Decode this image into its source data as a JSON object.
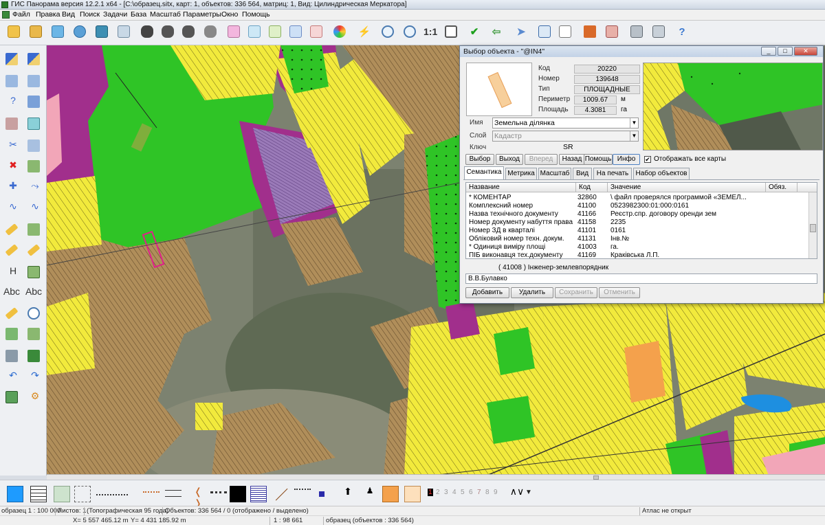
{
  "window": {
    "title": "ГИС Панорама версия 12.2.1 x64 - [C:\\образец.sitx, карт: 1, объектов: 336 564, матриц: 1, Вид: Цилиндрическая Меркатора]"
  },
  "menu": [
    "Файл",
    "Правка",
    "Вид",
    "Поиск",
    "Задачи",
    "База",
    "Масштаб",
    "Параметры",
    "Окно",
    "Помощь"
  ],
  "toolbar": {
    "scale_one_to_one": "1:1",
    "icons": [
      "open-folder-icon",
      "open-map-icon",
      "add-map-icon",
      "globe-info-icon",
      "layers-icon",
      "map-edit-icon",
      "binoculars-icon",
      "binoculars-search-icon",
      "binoculars-list-icon",
      "binoculars-area-icon",
      "select-object-icon",
      "select-add-icon",
      "select-plus-icon",
      "select-tag-icon",
      "select-clear-icon",
      "color-palette-icon",
      "lightning-icon",
      "zoom-out-icon",
      "zoom-in-icon",
      "zoom-fit-icon",
      "check-icon",
      "undo-icon",
      "pointer-icon",
      "monitor-icon",
      "text-document-icon",
      "tools-icon",
      "route-icon",
      "printer-icon",
      "print-preview-icon",
      "help-cursor-icon"
    ]
  },
  "left_toolbar": {
    "labels": [
      "H",
      "Abc",
      "Abc"
    ]
  },
  "dialog": {
    "title": "Выбор объекта - \"@IN4\"",
    "window_controls": [
      "_",
      "□",
      "✕"
    ],
    "attributes": [
      {
        "label": "Код",
        "value": "20220",
        "unit": ""
      },
      {
        "label": "Номер",
        "value": "139648",
        "unit": ""
      },
      {
        "label": "Тип",
        "value": "ПЛОЩАДНЫЕ",
        "unit": ""
      },
      {
        "label": "Периметр",
        "value": "1009.67",
        "unit": "м"
      },
      {
        "label": "Площадь",
        "value": "4.3081",
        "unit": "га"
      }
    ],
    "name_label": "Имя",
    "name_value": "Земельна ділянка",
    "layer_label": "Слой",
    "layer_value": "Кадастр",
    "key_label": "Ключ",
    "key_value": "SR",
    "buttons": [
      "Выбор",
      "Выход",
      "Вперед",
      "Назад",
      "Помощь",
      "Инфо"
    ],
    "show_all_maps": "Отображать все карты",
    "show_all_maps_checked": true,
    "tabs": [
      "Семантика",
      "Метрика",
      "Масштаб",
      "Вид",
      "На печать",
      "Набор объектов"
    ],
    "table_headers": [
      "Название",
      "Код",
      "Значение",
      "Обяз."
    ],
    "table_rows": [
      {
        "name": "* КОМЕНТАР",
        "code": "32860",
        "value": "\\ файл проверялся программой «ЗЕМЕЛ..."
      },
      {
        "name": "Комплексний номер",
        "code": "41100",
        "value": "0523982300:01:000:0161"
      },
      {
        "name": "Назва технічного документу",
        "code": "41166",
        "value": "Реєстр.спр. договору оренди зем"
      },
      {
        "name": "Номер документу набуття права",
        "code": "41158",
        "value": "2235"
      },
      {
        "name": "Номер ЗД в кварталі",
        "code": "41101",
        "value": "0161"
      },
      {
        "name": "Обліковий номер техн. докум.",
        "code": "41131",
        "value": "Інв.№"
      },
      {
        "name": "* Одиниця виміру площі",
        "code": "41003",
        "value": "га."
      },
      {
        "name": "ПІБ виконавця тех.документу",
        "code": "41169",
        "value": "Кракiвська Л.П."
      }
    ],
    "hint": "( 41008 ) Інженер-землевпорядник",
    "value_input": "В.В.Булавко",
    "bottom_buttons": [
      "Добавить",
      "Удалить",
      "Сохранить",
      "Отменить"
    ]
  },
  "bottom_toolbar": {
    "digits": [
      "1",
      "2",
      "3",
      "4",
      "5",
      "6",
      "7",
      "8",
      "9"
    ],
    "arrow_label": "▼"
  },
  "status": {
    "map_scale": "образец  1 : 100 000",
    "sheets": "Листов: 1",
    "projection": "(Топографическая 95 года)",
    "objects": "Объектов: 336 564 / 0 (отображено / выделено)",
    "atlas": "Атлас не открыт",
    "x_coord": "X= 5 557 465.12 m",
    "y_coord": "Y= 4 431 185.92 m",
    "current_scale": "1 : 98 661",
    "sample_objects": "образец   (объектов : 336 564)"
  },
  "colors": {
    "parcel_yellow": "#f5ed3b",
    "parcel_brown": "#a88a5c",
    "forest_green": "#2fc426",
    "purple": "#a12f8c",
    "orange": "#f4a14c",
    "water": "#1e8fe0",
    "pink": "#f2a6b8"
  }
}
